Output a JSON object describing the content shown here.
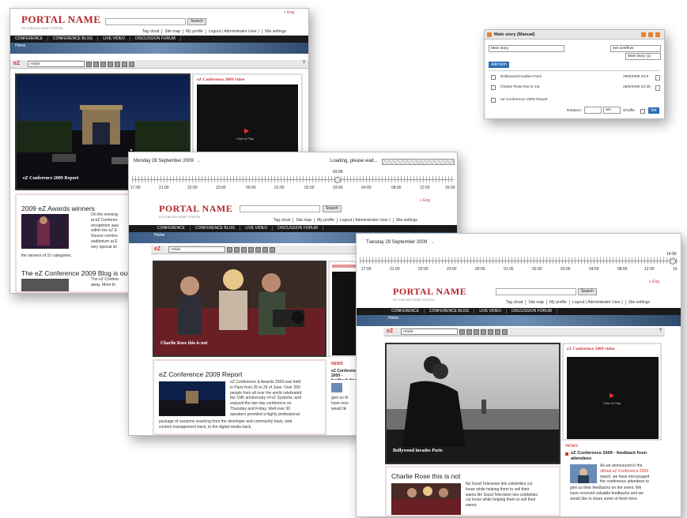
{
  "portal": {
    "logo": "PORTAL NAME",
    "logo_sub": "EZ PUBLISH DEMO PORTAL",
    "search_label": "Search",
    "lang": "» Eng",
    "links": [
      "Tag cloud",
      "Site map",
      "My profile",
      "Logout ( Administrator User )",
      "Site settings"
    ],
    "nav": [
      "CONFERENCE",
      "CONFERENCE BLOG",
      "LIVE VIDEO",
      "DISCUSSION FORUM"
    ],
    "breadcrumb": "Home",
    "toolbar_ez": "eZ",
    "toolbar_select": "Article"
  },
  "shot1": {
    "main_caption": "eZ Conference 2009 Report",
    "video_title": "eZ Conference 2009 video",
    "video_play": "Click to Play",
    "article1_title": "2009 eZ Awards winners",
    "article1_lines": [
      "On the evening",
      "at eZ Conferen",
      "recognition awa",
      "within the eZ E",
      "Source commu",
      "auditorium at E",
      "very special sh"
    ],
    "article1_tail": "the winners of 10 categories.",
    "article2_title": "The eZ Conference 2009 Blog is out !",
    "article2_lines": [
      "The eZ Confere",
      "away. More th"
    ]
  },
  "shot2": {
    "date": "Monday 28 September 2009",
    "loading": "Loading, please wait...",
    "time": "03:09",
    "hours": [
      "17:00",
      "21:00",
      "22:00",
      "23:00",
      "00:00",
      "01:00",
      "02:00",
      "03:00",
      "04:00",
      "08:00",
      "12:00",
      "16:00"
    ],
    "main_caption": "Charlie Rose this is not",
    "article_title": "eZ Conference 2009 Report",
    "article_lines": [
      "eZ Conference & Awards 2009 was held",
      "in Paris from 25 to 26 of June. Over 250",
      "people from all over the world celebrated",
      "the 10th anniversary of eZ Systems, and",
      "enjoyed the two day conference on",
      "Thursday and Friday. Well over 30",
      "speakers provided a highly professional"
    ],
    "article_tail1": "package of sessions reaching from the developer and community track, web",
    "article_tail2": "content management track, to the digital media track.",
    "side_news": "NEWS",
    "side_item": "eZ Conference 2009 - feedback from attendees",
    "side_lines": [
      "give us th",
      "have rece",
      "would lik"
    ]
  },
  "shot3": {
    "date": "Tuesday 29 September 2009",
    "time": "14:00",
    "hours": [
      "17:00",
      "21:00",
      "22:00",
      "23:00",
      "00:00",
      "01:00",
      "02:00",
      "03:00",
      "04:00",
      "08:00",
      "12:00",
      "16"
    ],
    "main_caption": "Bollywood invades Paris",
    "video_title": "eZ Conference 2009 video",
    "video_play": "Click to Play",
    "news_title": "NEWS",
    "news_item": "eZ Conference 2009 - feedback from attendees",
    "news_lines": [
      "As we announced in the",
      "official eZ Conference 2009",
      "report, we have encouraged",
      "the conference attendees to"
    ],
    "news_tail": [
      "give us their feedbacks on the event. We",
      "have received valuable feedbacks and we",
      "would like to share some of them here."
    ],
    "article_title": "Charlie Rose this is not",
    "article_lines": [
      "No Good Television lets celebrities cut",
      "loose while helping them to sell their",
      "wares.No Good Television lets celebrities",
      "cut loose while helping them to sell their",
      "wares."
    ]
  },
  "panel": {
    "title": "Main story (Manual)",
    "field_value": "Main story",
    "overflow_select": "Set overflow",
    "story_select": "Main story (1)",
    "add_button": "Add item",
    "items": [
      {
        "label": "Bollywood invades Paris",
        "date": "29/9/2009 20:9"
      },
      {
        "label": "Charlie Rose this is not",
        "date": "28/9/2009 23:30"
      },
      {
        "label": "eZ Conference 2009 Report",
        "date": ""
      }
    ],
    "rotation_label": "Rotation:",
    "rotation_unit": "sec",
    "shuffle_label": "Shuffle",
    "set_button": "Set"
  }
}
